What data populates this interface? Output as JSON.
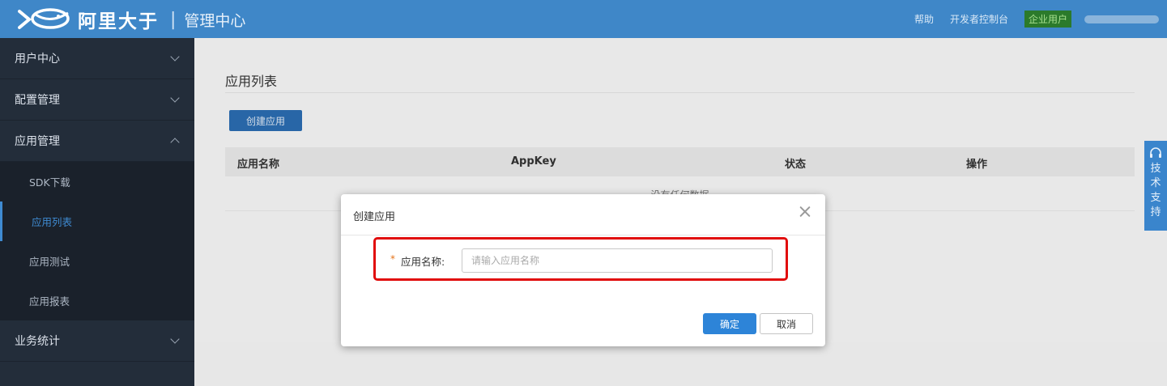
{
  "header": {
    "brand": "阿里大于",
    "separator": "|",
    "subtitle": "管理中心",
    "links": [
      "帮助",
      "开发者控制台"
    ],
    "badge": "企业用户",
    "logo_icon": "fish-logo-icon"
  },
  "sidebar": {
    "groups": [
      {
        "label": "用户中心",
        "expanded": false
      },
      {
        "label": "配置管理",
        "expanded": false
      },
      {
        "label": "应用管理",
        "expanded": true,
        "children": [
          {
            "label": "SDK下载",
            "active": false
          },
          {
            "label": "应用列表",
            "active": true
          },
          {
            "label": "应用测试",
            "active": false
          },
          {
            "label": "应用报表",
            "active": false
          }
        ]
      },
      {
        "label": "业务统计",
        "expanded": false
      }
    ]
  },
  "main": {
    "title": "应用列表",
    "create_button": "创建应用",
    "table": {
      "columns": [
        "应用名称",
        "AppKey",
        "状态",
        "操作"
      ],
      "empty_text": "没有任何数据"
    }
  },
  "modal": {
    "title": "创建应用",
    "required_mark": "*",
    "field_label": "应用名称:",
    "field_value": "",
    "field_placeholder": "请输入应用名称",
    "ok_label": "确定",
    "cancel_label": "取消"
  },
  "support_tab": {
    "chars": [
      "技",
      "术",
      "支",
      "持"
    ],
    "icon": "headset-icon"
  },
  "colors": {
    "header_bg": "#3f87c8",
    "sidebar_bg": "#232d3a",
    "accent": "#2d84d8",
    "highlight": "#e10b0b"
  }
}
